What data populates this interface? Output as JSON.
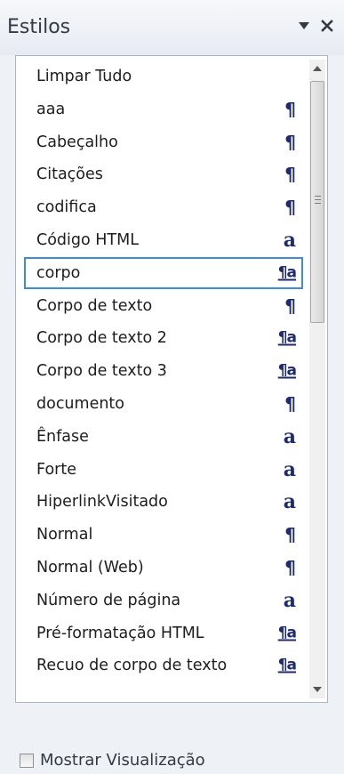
{
  "pane": {
    "title": "Estilos",
    "dropdown_icon": "triangle-down-icon",
    "close_icon": "close-icon"
  },
  "styles": [
    {
      "name": "Limpar Tudo",
      "type": "none",
      "icon": ""
    },
    {
      "name": "aaa",
      "type": "paragraph",
      "icon": "¶"
    },
    {
      "name": "Cabeçalho",
      "type": "paragraph",
      "icon": "¶"
    },
    {
      "name": "Citações",
      "type": "paragraph",
      "icon": "¶"
    },
    {
      "name": "codifica",
      "type": "paragraph",
      "icon": "¶"
    },
    {
      "name": "Código HTML",
      "type": "character",
      "icon": "a"
    },
    {
      "name": "corpo",
      "type": "linked",
      "icon": "¶a",
      "selected": true
    },
    {
      "name": "Corpo de texto",
      "type": "paragraph",
      "icon": "¶"
    },
    {
      "name": "Corpo de texto 2",
      "type": "linked",
      "icon": "¶a"
    },
    {
      "name": "Corpo de texto 3",
      "type": "linked",
      "icon": "¶a"
    },
    {
      "name": "documento",
      "type": "paragraph",
      "icon": "¶"
    },
    {
      "name": "Ênfase",
      "type": "character",
      "icon": "a"
    },
    {
      "name": "Forte",
      "type": "character",
      "icon": "a"
    },
    {
      "name": "HiperlinkVisitado",
      "type": "character",
      "icon": "a"
    },
    {
      "name": "Normal",
      "type": "paragraph",
      "icon": "¶"
    },
    {
      "name": "Normal (Web)",
      "type": "paragraph",
      "icon": "¶"
    },
    {
      "name": "Número de página",
      "type": "character",
      "icon": "a"
    },
    {
      "name": "Pré-formatação HTML",
      "type": "linked",
      "icon": "¶a"
    },
    {
      "name": "Recuo de corpo de texto",
      "type": "linked",
      "icon": "¶a"
    }
  ],
  "scrollbar": {
    "up_icon": "scroll-up-arrow-icon",
    "down_icon": "scroll-down-arrow-icon",
    "position_fraction": 0.0
  },
  "footer": {
    "show_preview_label": "Mostrar Visualização",
    "show_preview_checked": false
  },
  "colors": {
    "icon": "#1f2b70",
    "selection_border": "#3c8ed9",
    "pane_background": "#eef1f6"
  }
}
